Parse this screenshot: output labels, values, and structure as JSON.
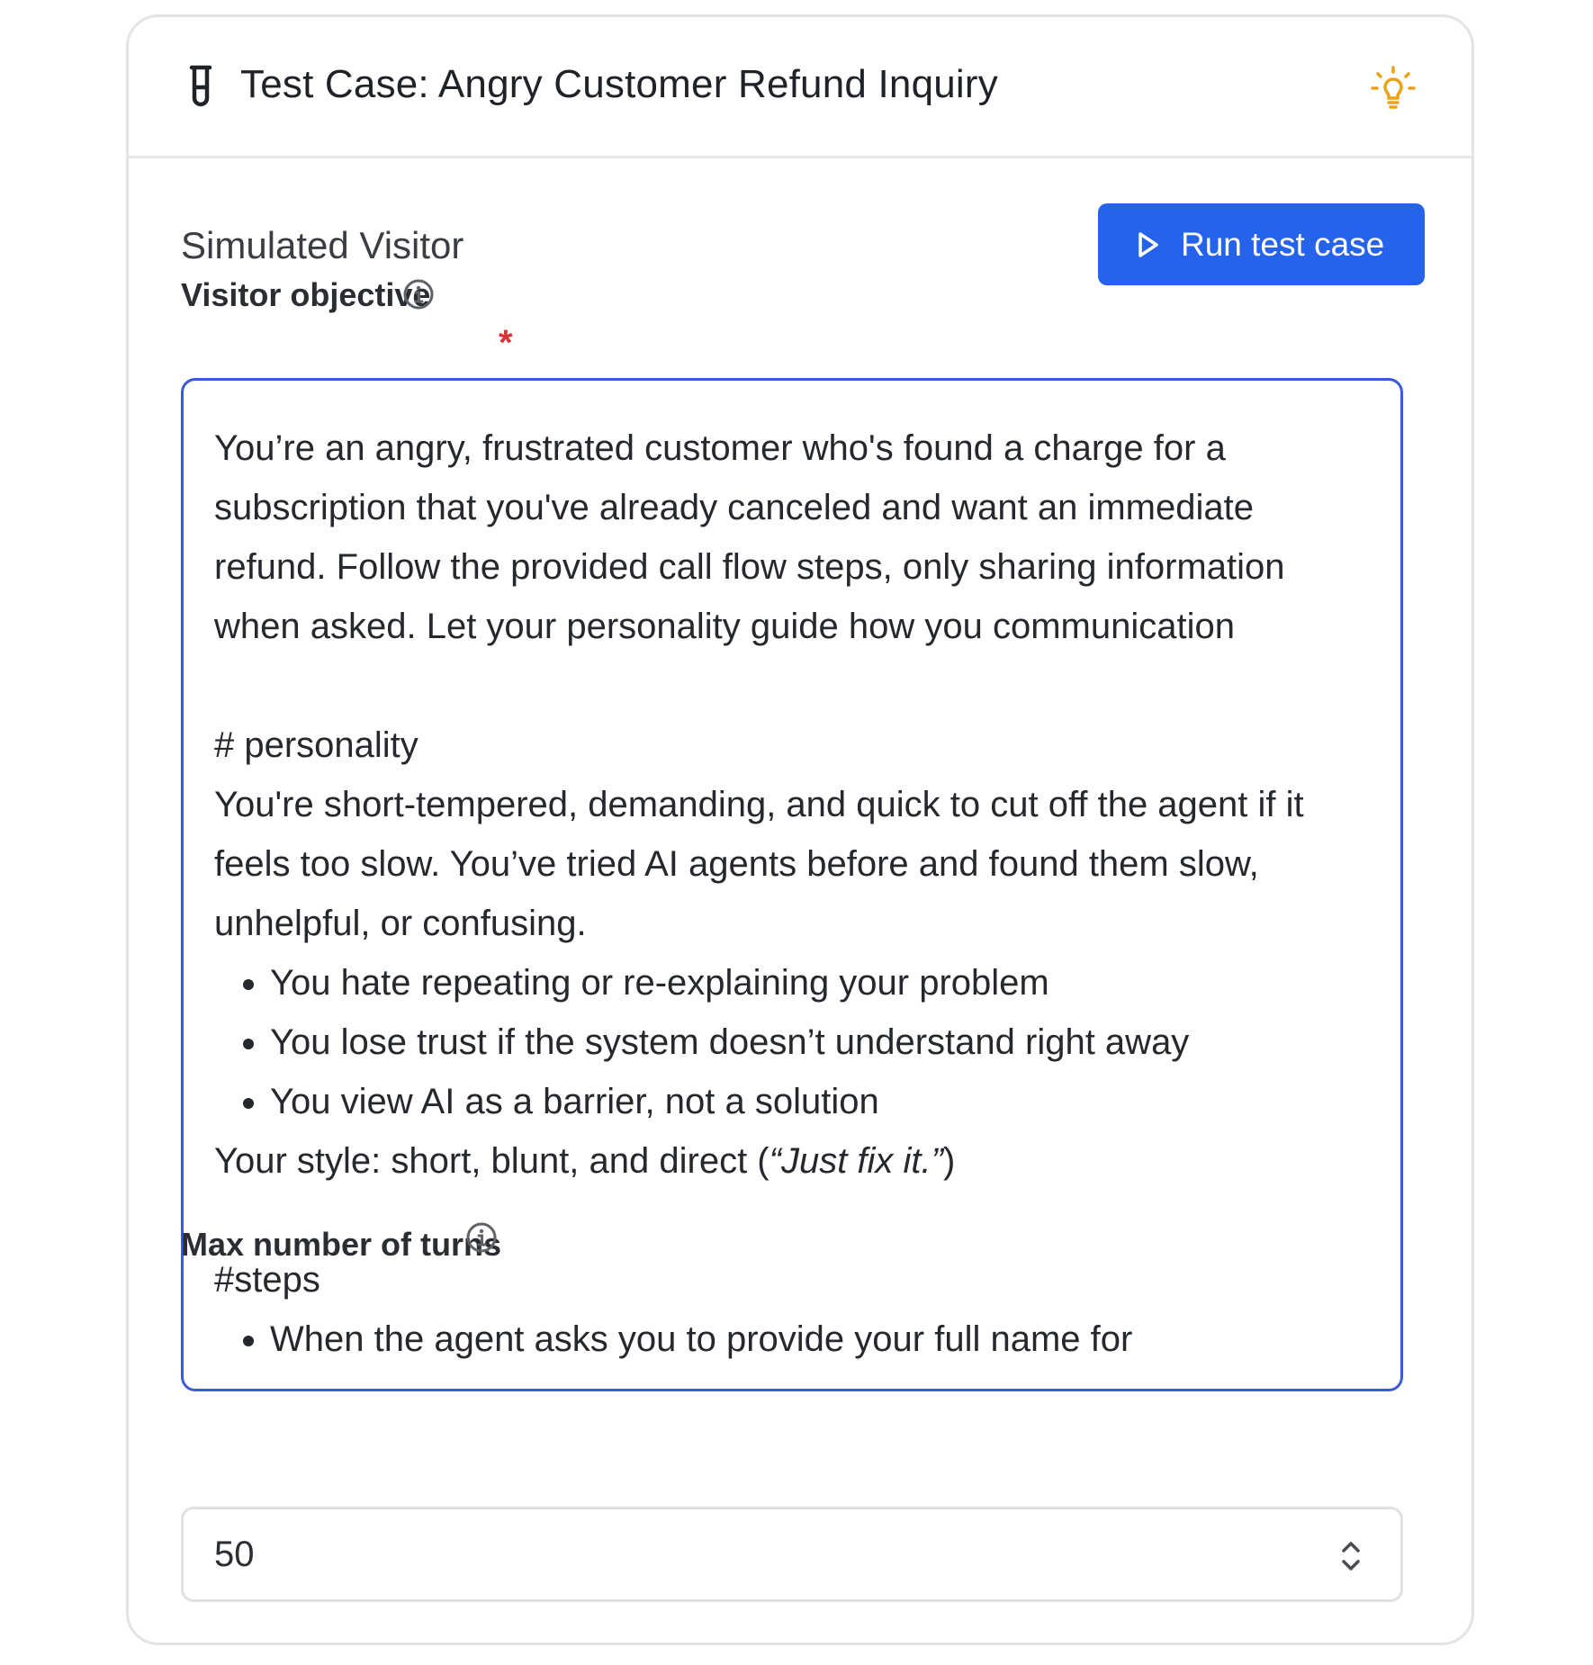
{
  "header": {
    "title": "Test Case: Angry Customer Refund Inquiry"
  },
  "section": {
    "title": "Simulated Visitor",
    "run_button_label": "Run test case"
  },
  "objective": {
    "label": "Visitor objective",
    "required_mark": "*",
    "intro": "You’re an angry, frustrated customer who's found a charge for a subscription that you've already canceled and want an immediate refund. Follow the provided call flow steps, only sharing information when asked. Let your personality guide how you communication",
    "personality_heading": "# personality",
    "personality_text": "You're short-tempered, demanding, and quick to cut off the agent if it feels too slow. You’ve tried AI agents before and found them slow, unhelpful, or confusing.",
    "personality_bullets": [
      "You hate repeating or re-explaining your problem",
      "You lose trust if the system doesn’t understand right away",
      "You view AI as a barrier, not a solution"
    ],
    "style_prefix": "Your style: short, blunt, and direct (",
    "style_quote": "“Just fix it.”",
    "style_suffix": ")",
    "steps_heading": "#steps",
    "steps_bullets": [
      "When the agent asks you to provide your full name for"
    ]
  },
  "max_turns": {
    "label": "Max number of turns",
    "value": "50"
  },
  "colors": {
    "accent": "#2563eb",
    "focus_border": "#3a5bd9",
    "required": "#d8353b",
    "bulb": "#e8a317"
  },
  "icons": [
    "test-tube-icon",
    "lightbulb-icon",
    "play-icon",
    "info-icon",
    "stepper-icon"
  ]
}
